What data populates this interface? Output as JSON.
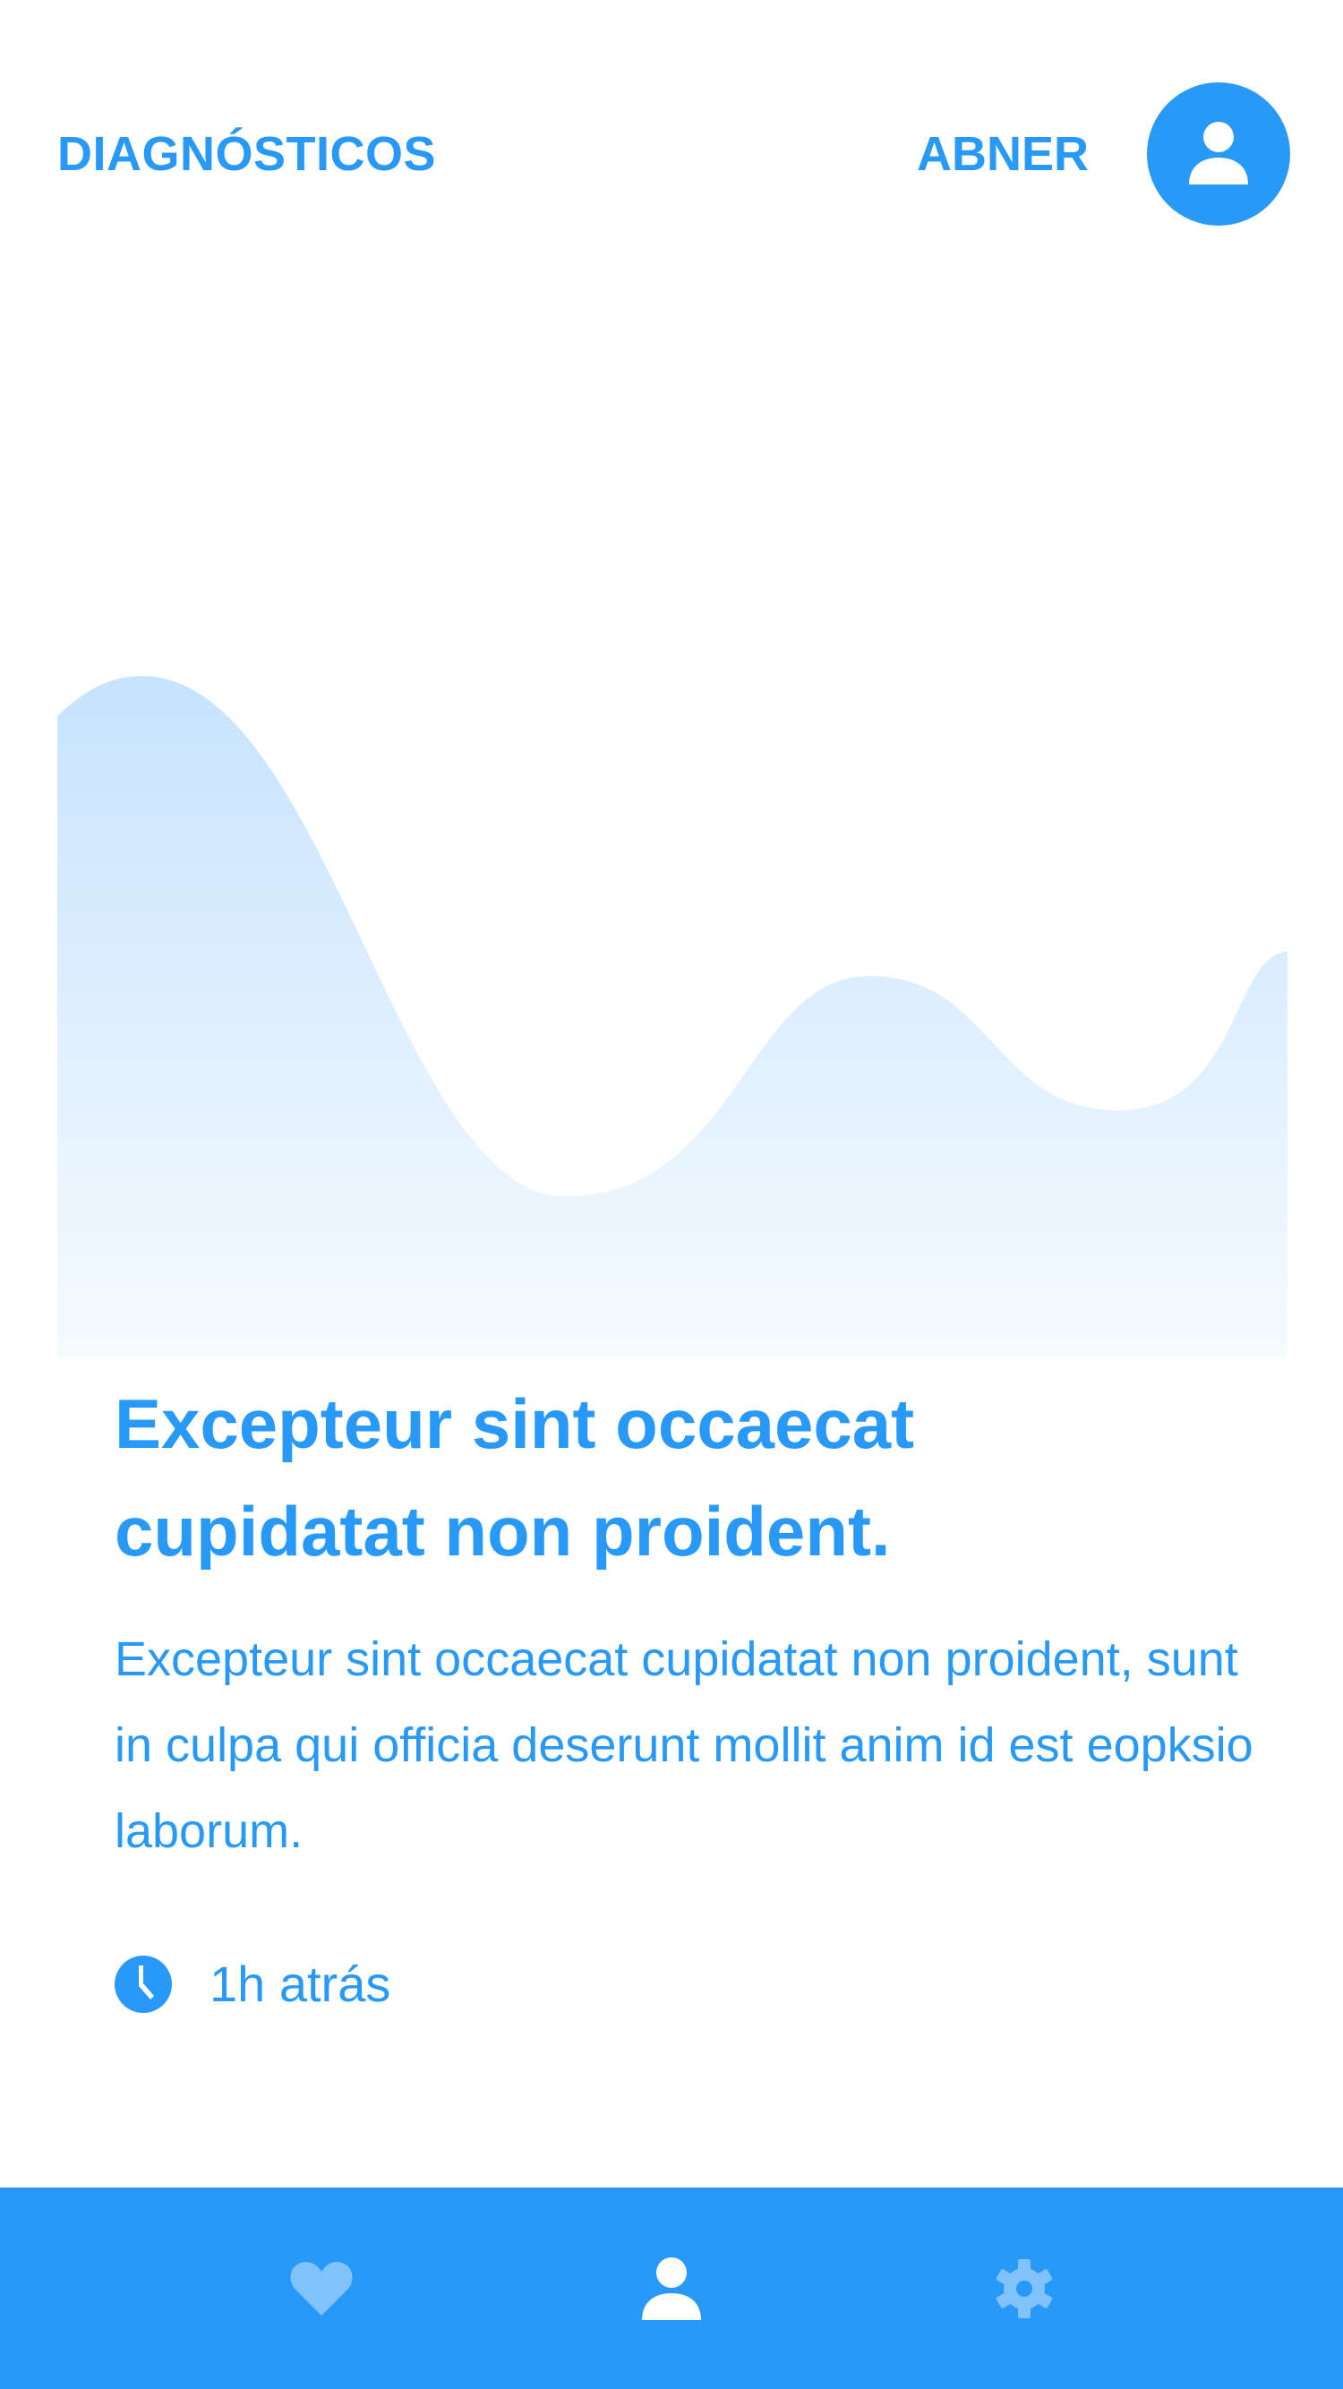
{
  "header": {
    "title": "DIAGNÓSTICOS",
    "user_name": "ABNER",
    "avatar_icon": "user-icon"
  },
  "article": {
    "title": "Excepteur sint occaecat cupidatat non proident.",
    "body": "Excepteur sint occaecat cupidatat non proident, sunt in culpa qui officia deserunt mollit anim id est eopksio laborum.",
    "time_icon": "clock-icon",
    "time_label": "1h atrás"
  },
  "bottom_nav": {
    "items": [
      {
        "icon": "heart-icon",
        "active": false
      },
      {
        "icon": "user-icon",
        "active": true
      },
      {
        "icon": "gear-icon",
        "active": false
      }
    ]
  },
  "colors": {
    "accent": "#2999f8",
    "wave_top": "#c7e3fd",
    "wave_bottom": "#f6fbff",
    "nav_inactive_icon": "#80c2fb",
    "nav_active_icon": "#ffffff"
  }
}
